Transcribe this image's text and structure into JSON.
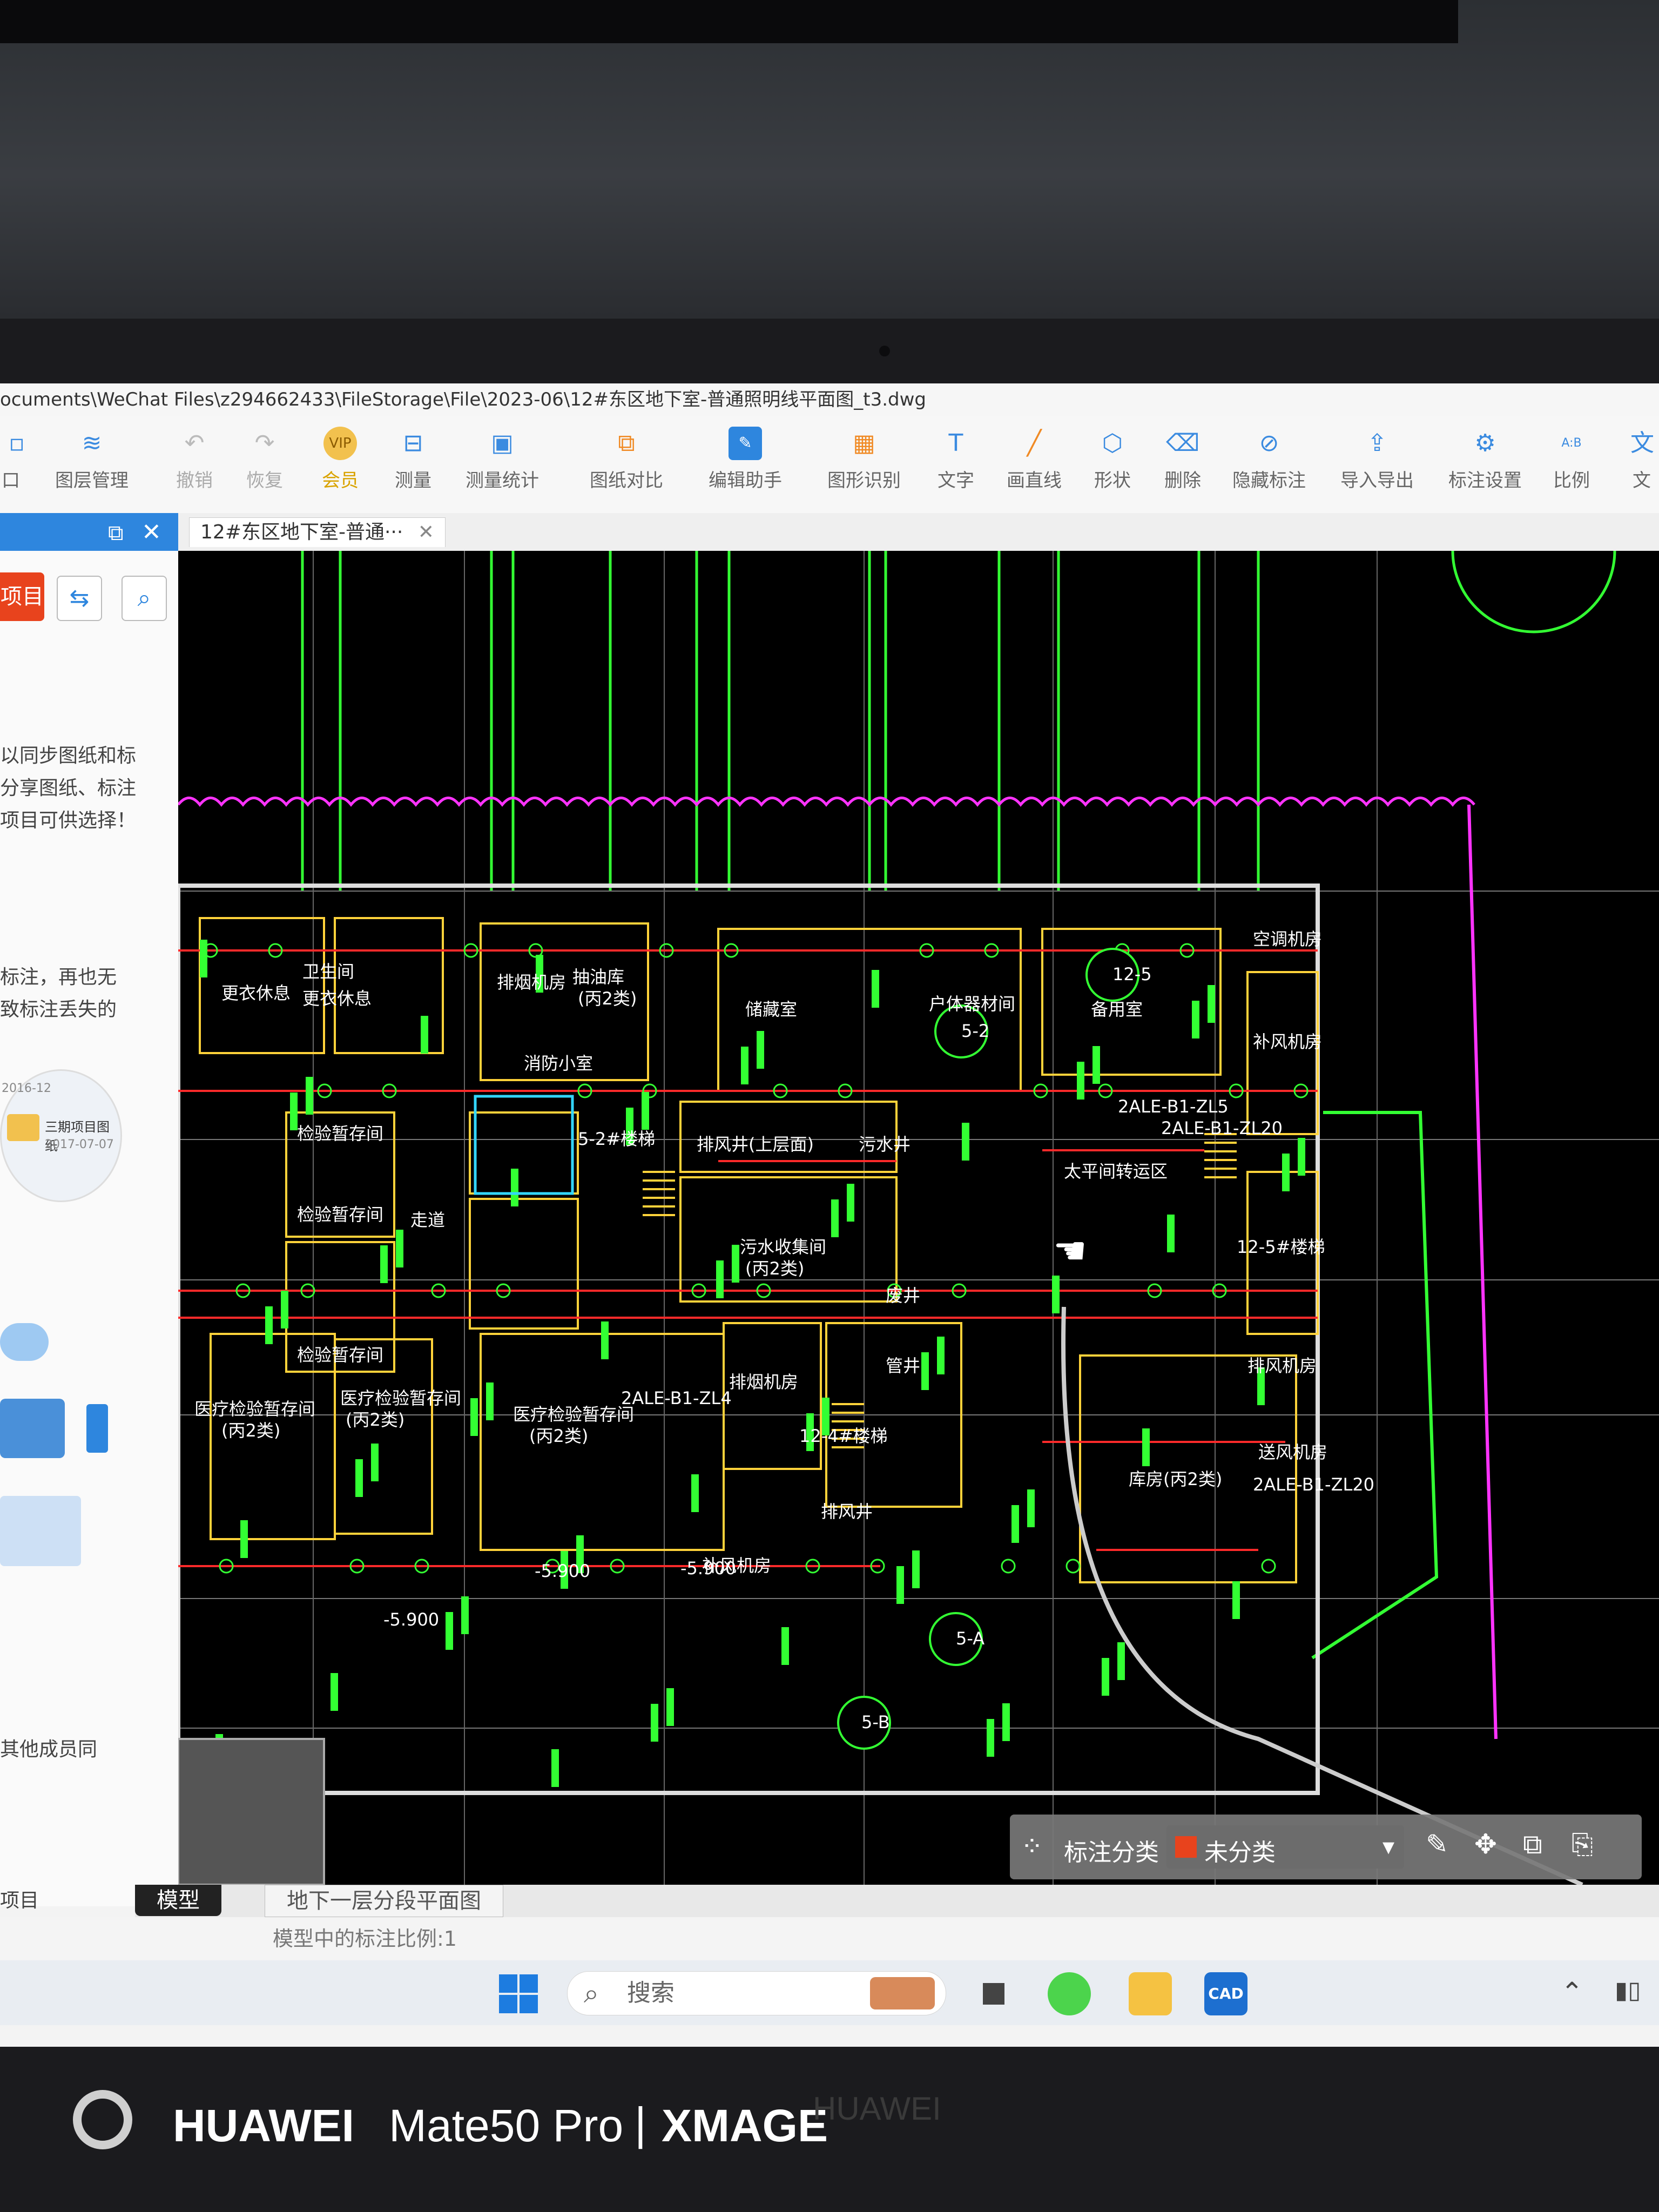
{
  "window": {
    "path": "ocuments\\WeChat Files\\z294662433\\FileStorage\\File\\2023-06\\12#东区地下室-普通照明线平面图_t3.dwg"
  },
  "ribbon": {
    "items": [
      {
        "label": "口",
        "icon": "window-icon"
      },
      {
        "label": "图层管理",
        "icon": "layers-icon"
      },
      {
        "label": "撤销",
        "icon": "undo-icon"
      },
      {
        "label": "恢复",
        "icon": "redo-icon"
      },
      {
        "label": "会员",
        "icon": "vip-icon",
        "badge": "VIP"
      },
      {
        "label": "测量",
        "icon": "measure-icon"
      },
      {
        "label": "测量统计",
        "icon": "measure-stats-icon"
      },
      {
        "label": "图纸对比",
        "icon": "compare-icon"
      },
      {
        "label": "编辑助手",
        "icon": "edit-assistant-icon"
      },
      {
        "label": "图形识别",
        "icon": "shape-recognize-icon"
      },
      {
        "label": "文字",
        "icon": "text-icon"
      },
      {
        "label": "画直线",
        "icon": "line-icon"
      },
      {
        "label": "形状",
        "icon": "shape-icon"
      },
      {
        "label": "删除",
        "icon": "eraser-icon"
      },
      {
        "label": "隐藏标注",
        "icon": "hide-annotation-icon"
      },
      {
        "label": "导入导出",
        "icon": "import-export-icon"
      },
      {
        "label": "标注设置",
        "icon": "annotation-settings-icon"
      },
      {
        "label": "比例",
        "icon": "scale-icon"
      },
      {
        "label": "文",
        "icon": "text2-icon"
      }
    ]
  },
  "doc_tab": {
    "label": "12#东区地下室-普通···"
  },
  "left_panel": {
    "button_label": "项目",
    "texts": [
      "以同步图纸和标",
      "分享图纸、标注",
      "项目可供选择！",
      "标注，再也无",
      "致标注丢失的",
      "其他成员同",
      "项目"
    ],
    "card_title": "三期项目图纸",
    "card_date_1": "2016-12",
    "card_date_2": "2017-07-07"
  },
  "drawing": {
    "labels": [
      "更衣休息",
      "更衣休息",
      "卫生间",
      "排烟机房",
      "抽油库",
      "(丙2类)",
      "消防小室",
      "储藏室",
      "户体器材间",
      "备用室",
      "空调机房",
      "补风机房",
      "检验暂存间",
      "检验暂存间",
      "检验暂存间",
      "走道",
      "5-2#楼梯",
      "排风井(上层面)",
      "污水井",
      "污水收集间",
      "(丙2类)",
      "废井",
      "太平间转运区",
      "12-5#楼梯",
      "排风机房",
      "送风机房",
      "医疗检验暂存间",
      "(丙2类)",
      "医疗检验暂存间",
      "(丙2类)",
      "医疗检验暂存间",
      "(丙2类)",
      "排烟机房",
      "12-4#楼梯",
      "管井",
      "排风井",
      "补风机房",
      "库房(丙2类)",
      "-5.900",
      "-5.900",
      "-5.900",
      "2ALE-B1-ZL4",
      "2ALE-B1-ZL5",
      "2ALE-B1-ZL20",
      "2ALE-B1-ZL20",
      "5-2",
      "12-5",
      "5-A",
      "5-B"
    ]
  },
  "annotation_bar": {
    "category_label": "标注分类",
    "selected_value": "未分类",
    "selected_color": "#e8431d"
  },
  "sheet_tabs": {
    "model": "模型",
    "layout": "地下一层分段平面图"
  },
  "status": {
    "text": "模型中的标注比例:1"
  },
  "taskbar": {
    "search_placeholder": "搜索",
    "apps": [
      "start-icon",
      "search-icon",
      "task-view-icon",
      "wechat-icon",
      "file-explorer-icon",
      "cad-app-icon"
    ],
    "cad_label": "CAD"
  },
  "watermark": {
    "brand": "HUAWEI",
    "model": "Mate50 Pro",
    "separator": "|",
    "xmage": "XMAGE",
    "ghost": "HUAWEI"
  },
  "colors": {
    "canvas_bg": "#000000",
    "green": "#33ff33",
    "red": "#ff2a2a",
    "yellow": "#ffd23a",
    "magenta": "#ff33ff",
    "cyan": "#33d6ff",
    "white": "#ffffff",
    "accent_blue": "#2e86de"
  }
}
